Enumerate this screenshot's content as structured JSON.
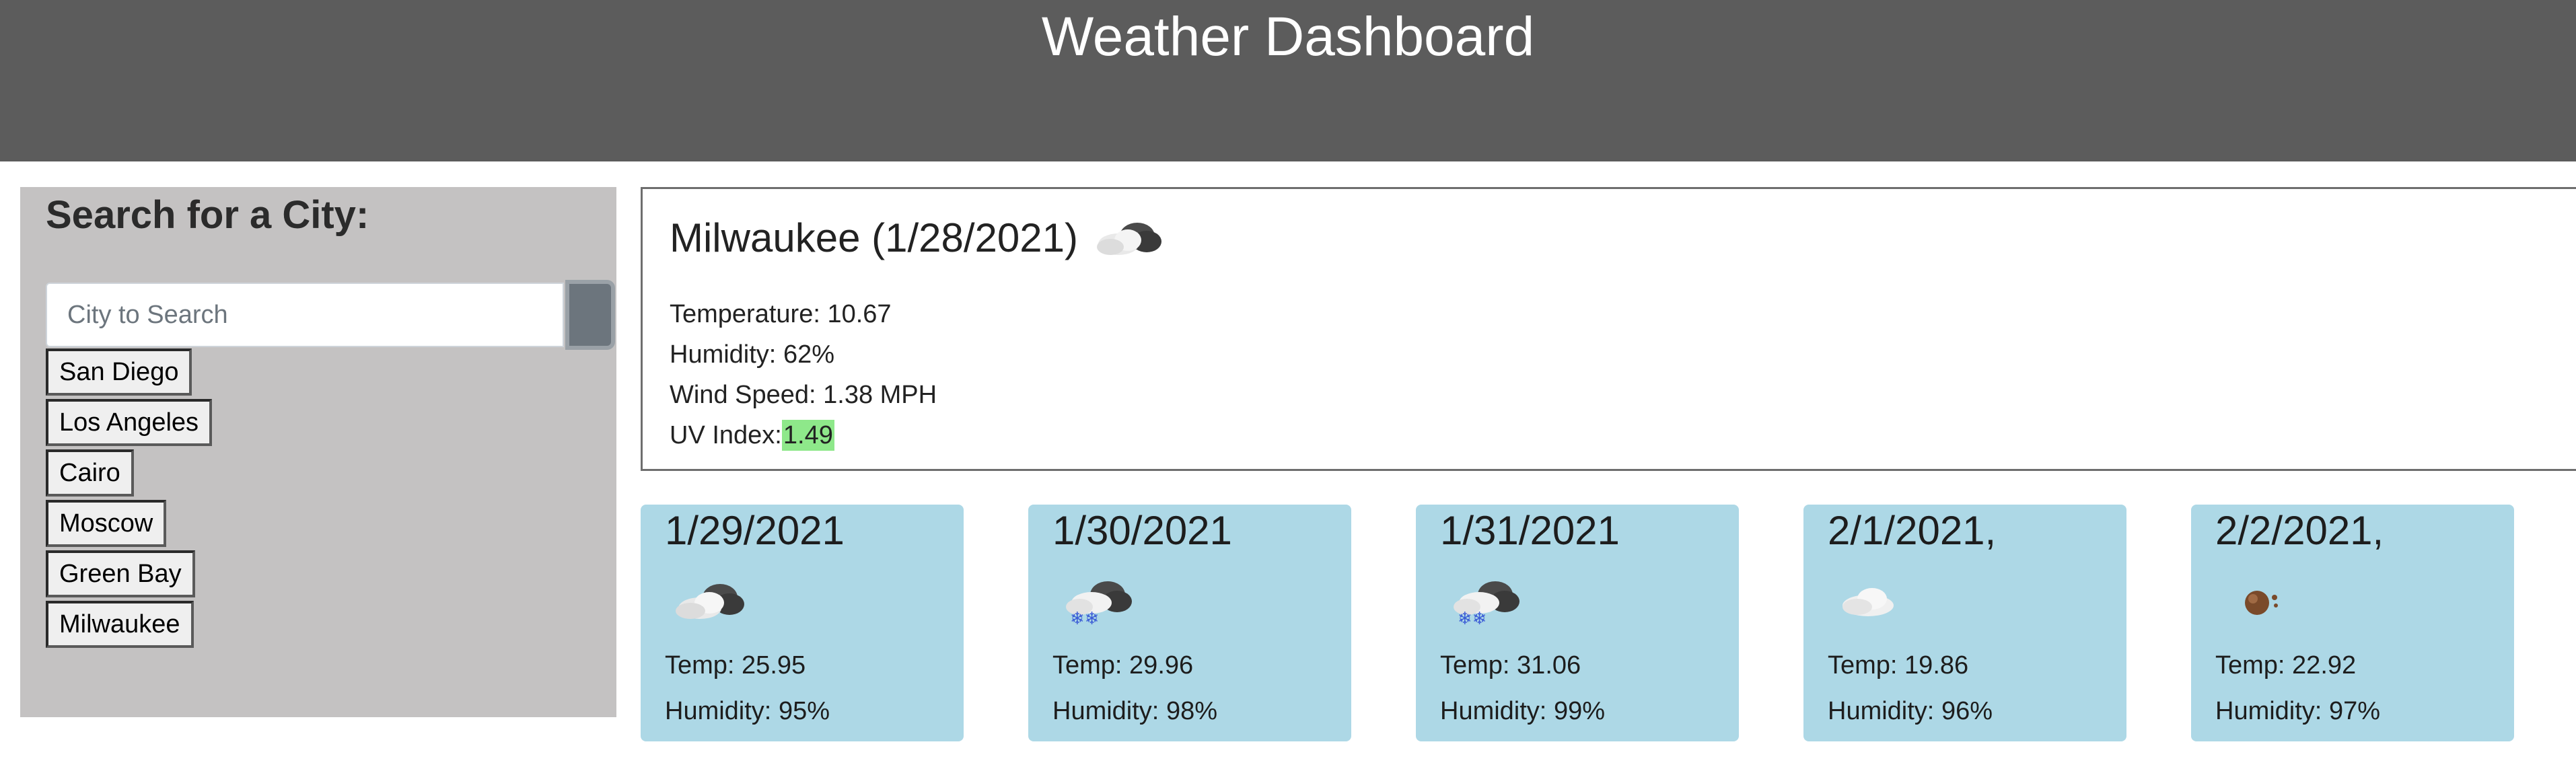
{
  "header": {
    "title": "Weather Dashboard"
  },
  "sidebar": {
    "title": "Search for a City:",
    "search_placeholder": "City to Search",
    "search_value": "",
    "cities": [
      "San Diego",
      "Los Angeles",
      "Cairo",
      "Moscow",
      "Green Bay",
      "Milwaukee"
    ]
  },
  "current": {
    "heading": "Milwaukee (1/28/2021)",
    "icon": "partly-cloudy-icon",
    "temperature_label": "Temperature:",
    "temperature_value": "10.67",
    "humidity_label": "Humidity:",
    "humidity_value": "62%",
    "wind_label": "Wind Speed:",
    "wind_value": "1.38 MPH",
    "uv_label": "UV Index:",
    "uv_value": "1.49",
    "uv_color": "#8ee88a"
  },
  "forecast": [
    {
      "date": "1/29/2021",
      "icon": "partly-cloudy-icon",
      "temp_label": "Temp:",
      "temp": "25.95",
      "humidity_label": "Humidity:",
      "humidity": "95%"
    },
    {
      "date": "1/30/2021",
      "icon": "snow-icon",
      "temp_label": "Temp:",
      "temp": "29.96",
      "humidity_label": "Humidity:",
      "humidity": "98%"
    },
    {
      "date": "1/31/2021",
      "icon": "snow-icon",
      "temp_label": "Temp:",
      "temp": "31.06",
      "humidity_label": "Humidity:",
      "humidity": "99%"
    },
    {
      "date": "2/1/2021,",
      "icon": "cloud-icon",
      "temp_label": "Temp:",
      "temp": "19.86",
      "humidity_label": "Humidity:",
      "humidity": "96%"
    },
    {
      "date": "2/2/2021,",
      "icon": "haze-icon",
      "temp_label": "Temp:",
      "temp": "22.92",
      "humidity_label": "Humidity:",
      "humidity": "97%"
    }
  ],
  "colors": {
    "header_bg": "#5c5c5c",
    "sidebar_bg": "#c4c2c2",
    "forecast_bg": "#add8e6",
    "search_button": "#6c757d"
  }
}
